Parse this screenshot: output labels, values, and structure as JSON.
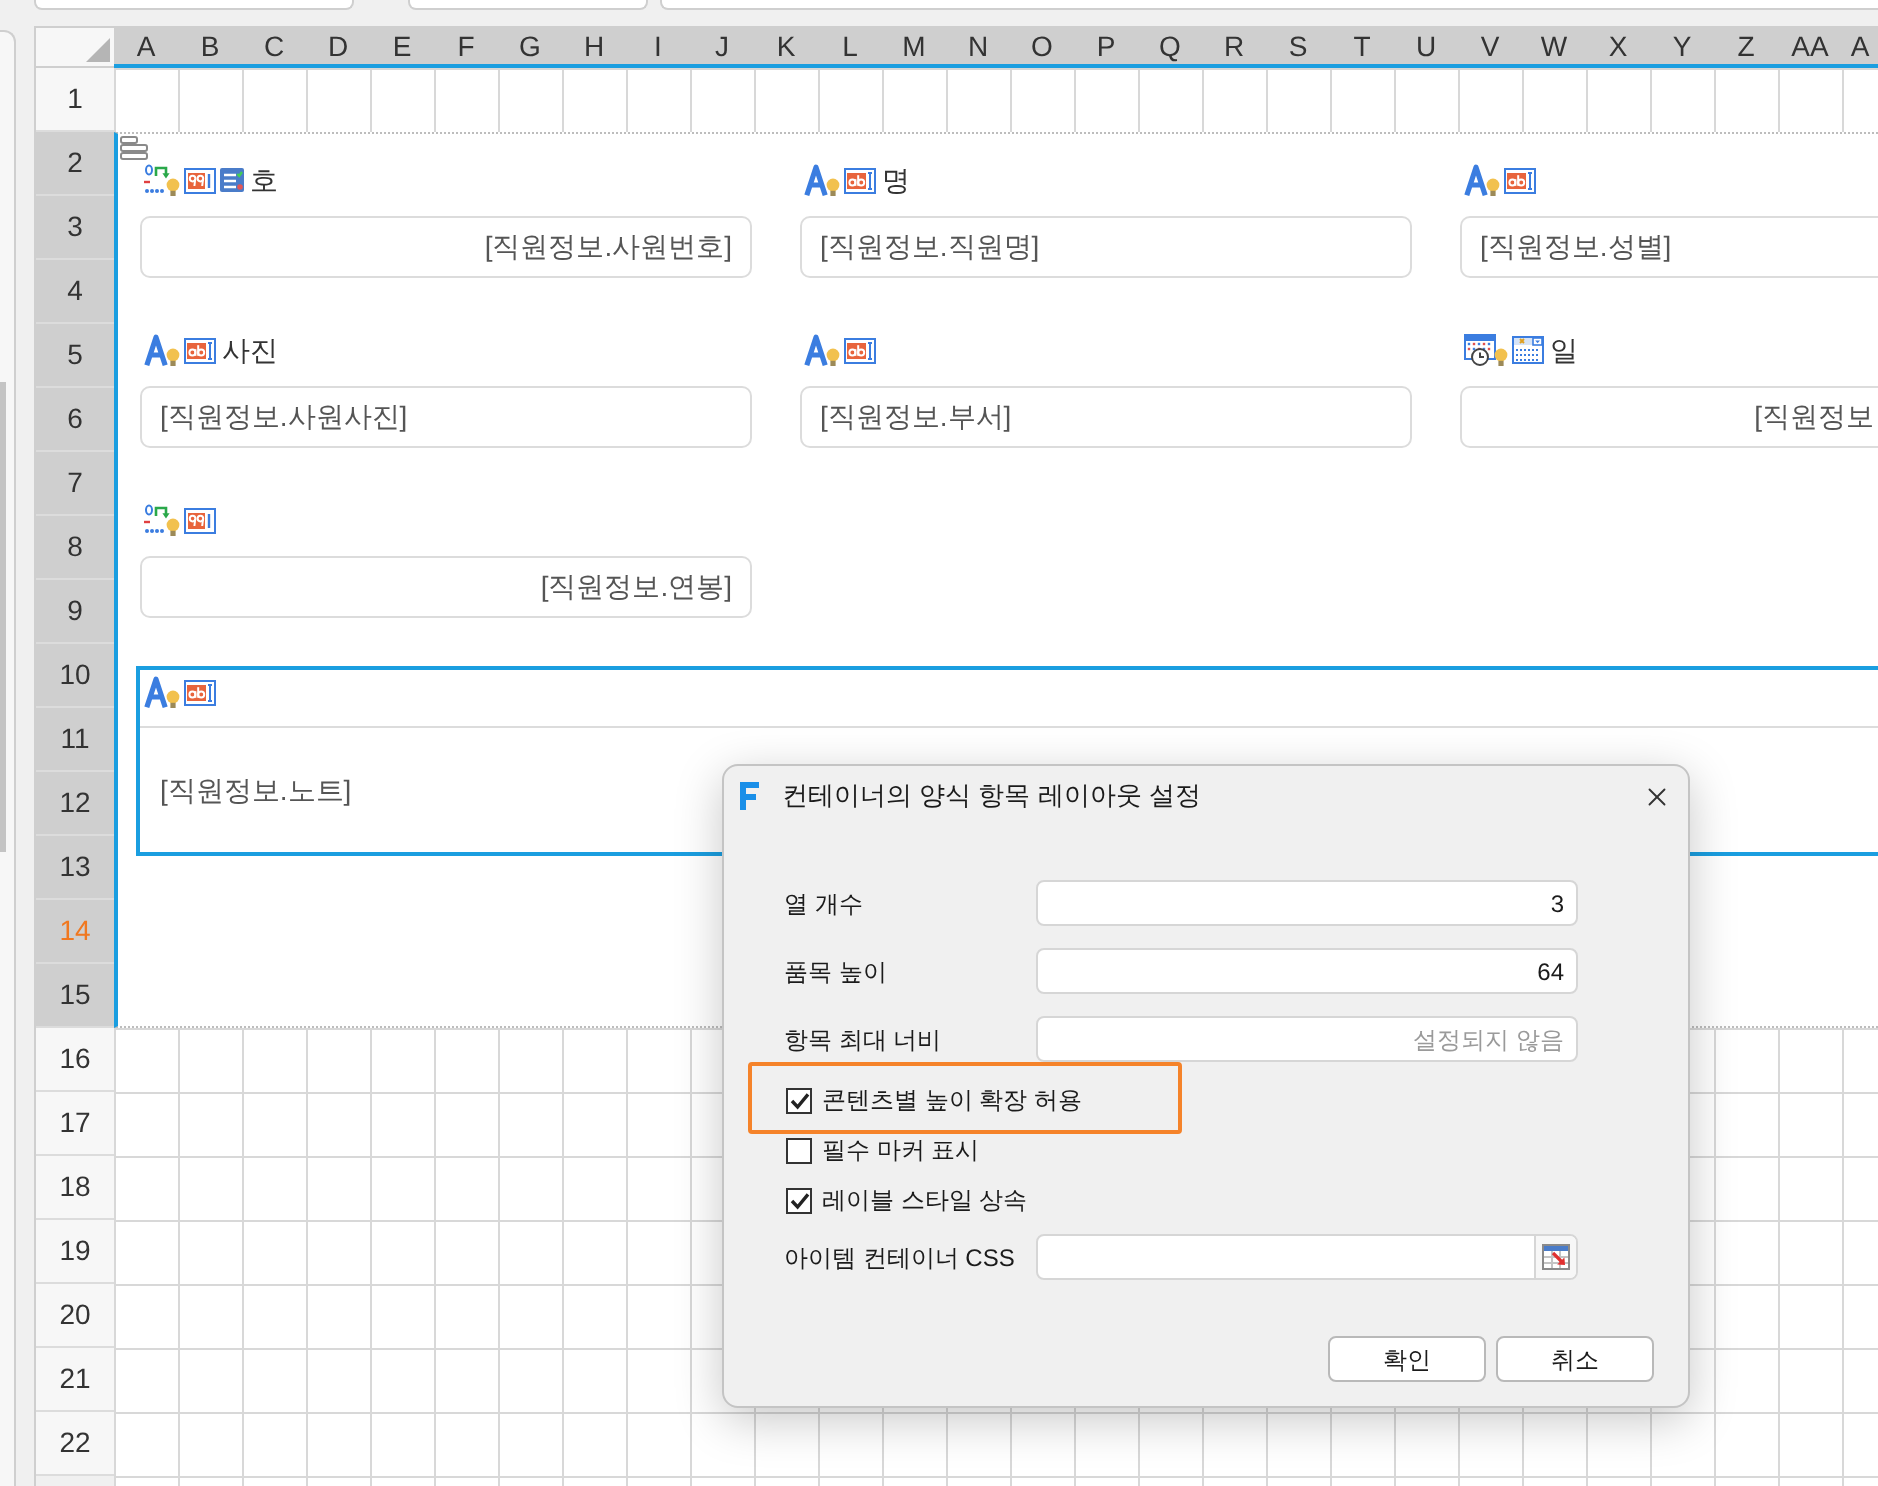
{
  "sheet": {
    "columns": [
      "A",
      "B",
      "C",
      "D",
      "E",
      "F",
      "G",
      "H",
      "I",
      "J",
      "K",
      "L",
      "M",
      "N",
      "O",
      "P",
      "Q",
      "R",
      "S",
      "T",
      "U",
      "V",
      "W",
      "X",
      "Y",
      "Z",
      "AA",
      "A"
    ],
    "rows": [
      {
        "label": "1",
        "selected": false,
        "current": false
      },
      {
        "label": "2",
        "selected": true,
        "current": false
      },
      {
        "label": "3",
        "selected": true,
        "current": false
      },
      {
        "label": "4",
        "selected": true,
        "current": false
      },
      {
        "label": "5",
        "selected": true,
        "current": false
      },
      {
        "label": "6",
        "selected": true,
        "current": false
      },
      {
        "label": "7",
        "selected": true,
        "current": false
      },
      {
        "label": "8",
        "selected": true,
        "current": false
      },
      {
        "label": "9",
        "selected": true,
        "current": false
      },
      {
        "label": "10",
        "selected": true,
        "current": false
      },
      {
        "label": "11",
        "selected": true,
        "current": false
      },
      {
        "label": "12",
        "selected": true,
        "current": false
      },
      {
        "label": "13",
        "selected": true,
        "current": false
      },
      {
        "label": "14",
        "selected": true,
        "current": true
      },
      {
        "label": "15",
        "selected": true,
        "current": false
      },
      {
        "label": "16",
        "selected": false,
        "current": false
      },
      {
        "label": "17",
        "selected": false,
        "current": false
      },
      {
        "label": "18",
        "selected": false,
        "current": false
      },
      {
        "label": "19",
        "selected": false,
        "current": false
      },
      {
        "label": "20",
        "selected": false,
        "current": false
      },
      {
        "label": "21",
        "selected": false,
        "current": false
      },
      {
        "label": "22",
        "selected": false,
        "current": false
      }
    ]
  },
  "form": {
    "selected": true,
    "items": [
      {
        "kind": "code",
        "label": "호",
        "value": "[직원정보.사원번호]",
        "selected": false
      },
      {
        "kind": "text",
        "label": "명",
        "value": "[직원정보.직원명]",
        "selected": false
      },
      {
        "kind": "text",
        "value": "[직원정보.성별]",
        "selected": false
      },
      {
        "kind": "text",
        "label": "사진",
        "value": "[직원정보.사원사진]",
        "selected": false
      },
      {
        "kind": "text",
        "value": "[직원정보.부서]",
        "selected": false
      },
      {
        "kind": "date",
        "label": "일",
        "value": "[직원정보",
        "selected": false
      },
      {
        "kind": "number",
        "value": "[직원정보.연봉]",
        "selected": false
      },
      {
        "kind": "memo",
        "value": "[직원정보.노트]",
        "selected": true
      }
    ]
  },
  "dialog": {
    "title": "컨테이너의 양식 항목 레이아웃 설정",
    "rows": [
      {
        "kind": "input",
        "label": "열 개수",
        "value": "3"
      },
      {
        "kind": "input",
        "label": "품목 높이",
        "value": "64"
      },
      {
        "kind": "input",
        "label": "항목 최대 너비",
        "placeholder": "설정되지 않음"
      },
      {
        "kind": "checkbox",
        "label": "콘텐츠별 높이 확장 허용",
        "checked": true,
        "highlighted": true
      },
      {
        "kind": "checkbox",
        "label": "필수 마커 표시",
        "checked": false,
        "highlighted": false
      },
      {
        "kind": "checkbox",
        "label": "레이블 스타일 상속",
        "checked": true,
        "highlighted": false
      },
      {
        "kind": "picker",
        "label": "아이템 컨테이너 CSS"
      }
    ],
    "buttons": [
      "확인",
      "취소"
    ]
  }
}
